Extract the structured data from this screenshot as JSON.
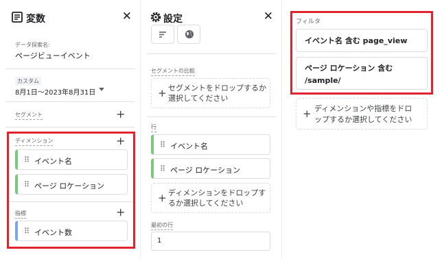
{
  "left_panel": {
    "title": "変数",
    "close": "✕",
    "exploration_name_label": "データ探索名:",
    "exploration_name": "ページビューイベント",
    "date_custom_label": "カスタム",
    "date_range": "8月1日～2023年8月31日",
    "segments_label": "セグメント",
    "dimensions_label": "ディメンション",
    "dimensions": [
      "イベント名",
      "ページ ロケーション"
    ],
    "metrics_label": "指標",
    "metrics": [
      "イベント数"
    ]
  },
  "middle_panel": {
    "title": "設定",
    "close": "✕",
    "segment_compare_label": "セグメントの比較",
    "segment_drop_text": [
      "セグメントをドロップするか",
      "選択してください"
    ],
    "rows_label": "行",
    "rows": [
      "イベント名",
      "ページ ロケーション"
    ],
    "rows_drop_text": [
      "ディメンションをドロップす",
      "るか選択してください"
    ],
    "first_row_label": "最初の行",
    "first_row_value": "1"
  },
  "right_panel": {
    "filters_label": "フィルタ",
    "filters": [
      [
        "イベント名 含む page_view"
      ],
      [
        "ページ ロケーション 含む",
        "/sample/"
      ]
    ],
    "drop_text": [
      "ディメンションや指標をドロ",
      "ップするか選択してください"
    ]
  },
  "icons": {
    "variables": "variables-icon",
    "settings": "gear-icon",
    "grip": "drag-handle-icon",
    "plus": "plus-icon",
    "dropdown": "dropdown-arrow-icon"
  },
  "colors": {
    "highlight": "#e0242f",
    "dimension_accent": "#7cc67d",
    "metric_accent": "#7ba7e8"
  }
}
